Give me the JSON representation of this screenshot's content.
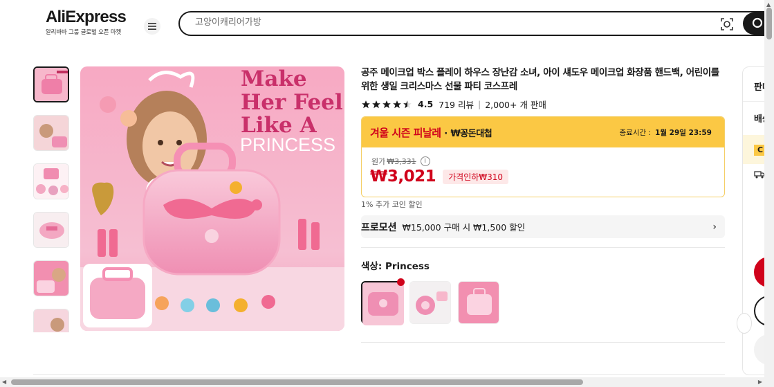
{
  "header": {
    "logo_text": "AliExpress",
    "logo_subtitle": "알리바바 그룹 글로벌 오픈 마켓",
    "search_placeholder": "고양이캐리어가방"
  },
  "product": {
    "title": "공주 메이크업 박스 플레이 하우스 장난감 소녀, 아이 섀도우 메이크업 화장품 핸드백, 어린이를위한 생일 크리스마스 선물 파티 코스프레",
    "rating": 4.5,
    "rating_text": "4.5",
    "reviews": "719 리뷰",
    "sold": "2,000+ 개 판매",
    "image_text": [
      "Make",
      "Her Feel",
      "Like A",
      "PRINCESS"
    ]
  },
  "sale": {
    "name": "겨울 시즌 피날레",
    "dot_sep": "·",
    "subtitle": "₩꽁돈대첩",
    "end_label": "종료시간 :",
    "end_time": "1월 29일 23:59",
    "original_label": "원가",
    "original_price": "₩3,331",
    "price": "₩3,021",
    "discount": "가격인하₩310",
    "accent": "#d0021b",
    "banner_color": "#fbc844"
  },
  "coin_text": "1% 추가 코인 할인",
  "promotion": {
    "tag": "프로모션",
    "text": "₩15,000 구매 시 ₩1,500 할인",
    "chevron": "›"
  },
  "color": {
    "label": "색상: Princess",
    "selected_index": 0
  },
  "right_panel": {
    "text1": "판매",
    "text2": "배송",
    "coupon": "C"
  },
  "icons": {
    "menu": "menu-icon",
    "camera": "camera-search-icon",
    "search": "search-icon",
    "info": "info-icon",
    "chevron": "chevron-right-icon",
    "truck": "truck-icon"
  },
  "info_glyph": "i",
  "scroll_up": "▲",
  "scroll_left": "◀",
  "scroll_right": "▶"
}
